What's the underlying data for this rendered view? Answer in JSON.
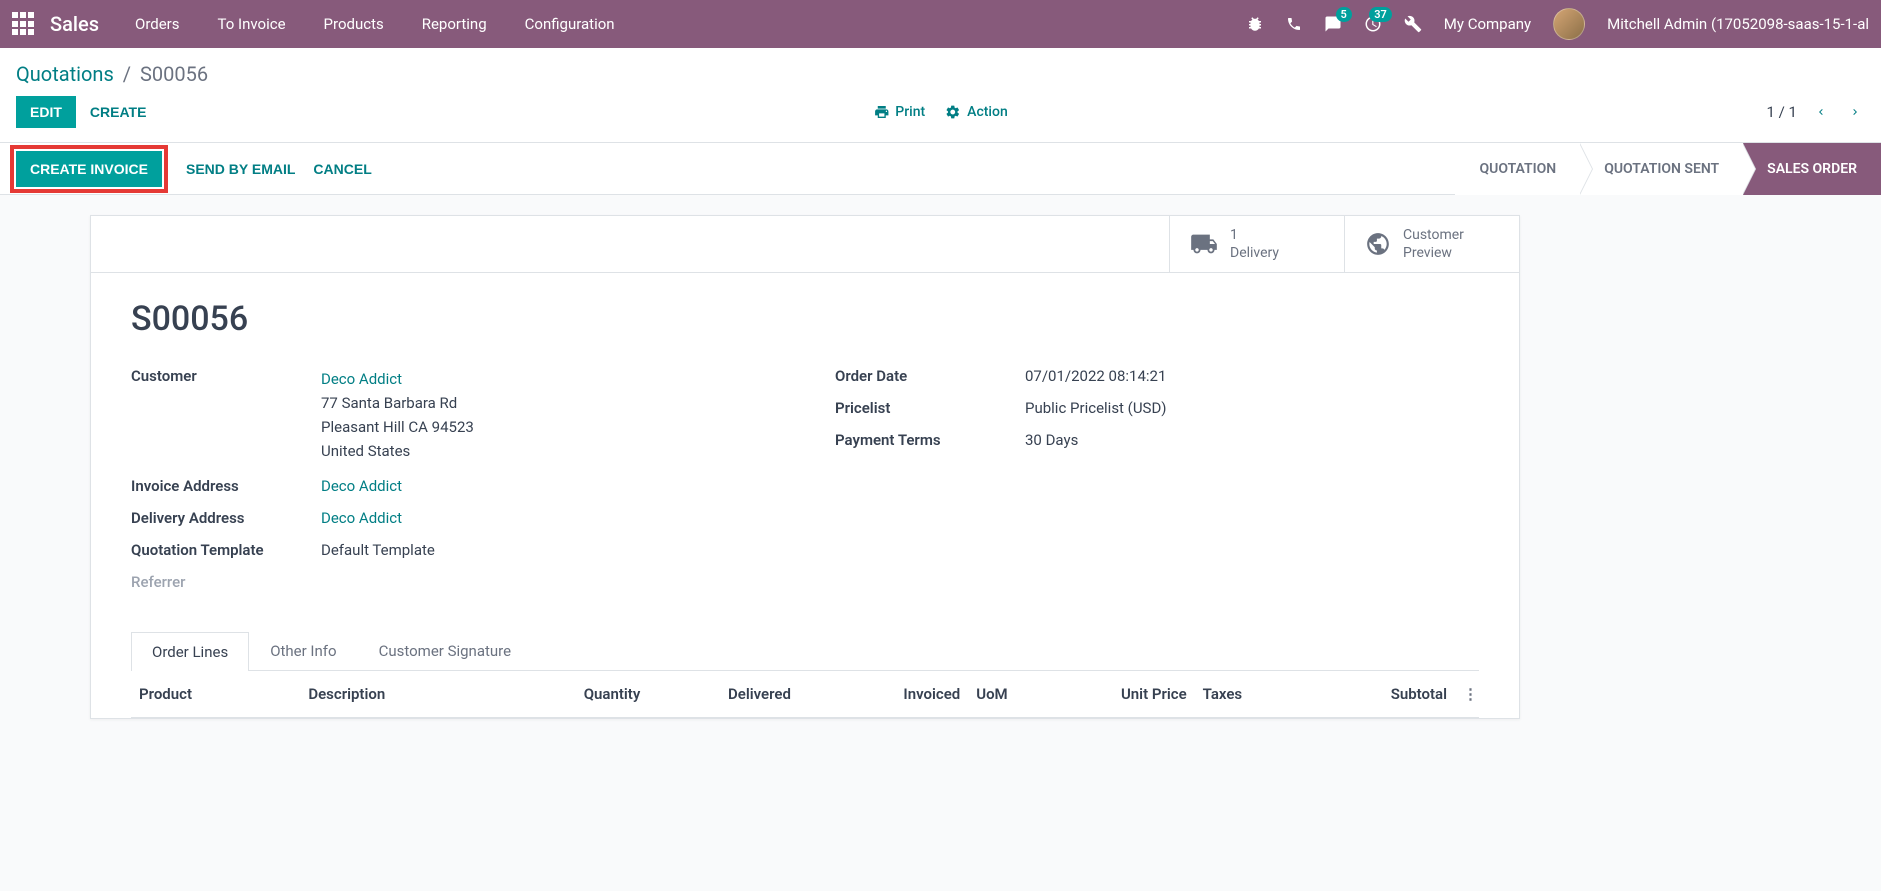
{
  "topbar": {
    "app_name": "Sales",
    "nav": [
      "Orders",
      "To Invoice",
      "Products",
      "Reporting",
      "Configuration"
    ],
    "messages_badge": "5",
    "activities_badge": "37",
    "company": "My Company",
    "user": "Mitchell Admin (17052098-saas-15-1-al"
  },
  "breadcrumb": {
    "parent": "Quotations",
    "current": "S00056"
  },
  "controls": {
    "edit": "EDIT",
    "create": "CREATE",
    "print": "Print",
    "action": "Action",
    "pager": "1 / 1"
  },
  "status_bar": {
    "create_invoice": "CREATE INVOICE",
    "send_email": "SEND BY EMAIL",
    "cancel": "CANCEL",
    "steps": [
      "QUOTATION",
      "QUOTATION SENT",
      "SALES ORDER"
    ]
  },
  "stat_buttons": {
    "delivery_count": "1",
    "delivery_label": "Delivery",
    "preview_line1": "Customer",
    "preview_line2": "Preview"
  },
  "order": {
    "name": "S00056",
    "customer_label": "Customer",
    "customer_name": "Deco Addict",
    "customer_street": "77 Santa Barbara Rd",
    "customer_city": "Pleasant Hill CA 94523",
    "customer_country": "United States",
    "invoice_addr_label": "Invoice Address",
    "invoice_addr": "Deco Addict",
    "delivery_addr_label": "Delivery Address",
    "delivery_addr": "Deco Addict",
    "template_label": "Quotation Template",
    "template": "Default Template",
    "referrer_label": "Referrer",
    "order_date_label": "Order Date",
    "order_date": "07/01/2022 08:14:21",
    "pricelist_label": "Pricelist",
    "pricelist": "Public Pricelist (USD)",
    "payment_terms_label": "Payment Terms",
    "payment_terms": "30 Days"
  },
  "tabs": [
    "Order Lines",
    "Other Info",
    "Customer Signature"
  ],
  "columns": {
    "product": "Product",
    "description": "Description",
    "quantity": "Quantity",
    "delivered": "Delivered",
    "invoiced": "Invoiced",
    "uom": "UoM",
    "unit_price": "Unit Price",
    "taxes": "Taxes",
    "subtotal": "Subtotal"
  }
}
